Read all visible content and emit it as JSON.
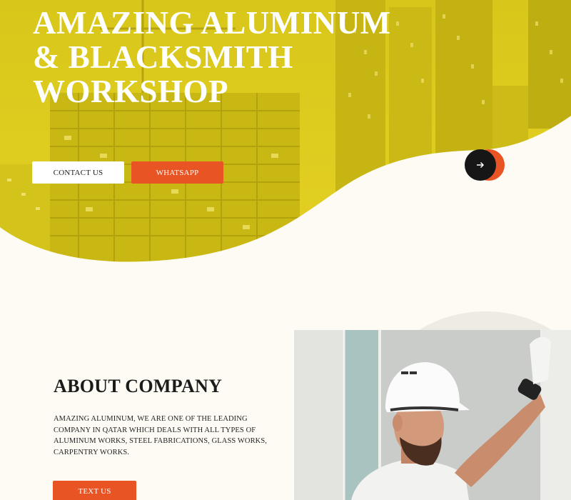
{
  "hero": {
    "title": "AMAZING ALUMINUM & BLACKSMITH WORKSHOP",
    "contact_label": "CONTACT US",
    "whatsapp_label": "WHATSAPP",
    "next_arrow_icon": "arrow-right-icon",
    "overlay_color": "#d9c918"
  },
  "about": {
    "title": "ABOUT COMPANY",
    "description": "AMAZING ALUMINUM, WE ARE ONE OF THE LEADING COMPANY IN QATAR WHICH DEALS WITH ALL TYPES OF ALUMINUM WORKS, STEEL FABRICATIONS, GLASS WORKS, CARPENTRY WORKS.",
    "button_label": "TEXT US"
  },
  "colors": {
    "accent": "#e85424",
    "background": "#fdfbf4",
    "dark": "#161616"
  }
}
